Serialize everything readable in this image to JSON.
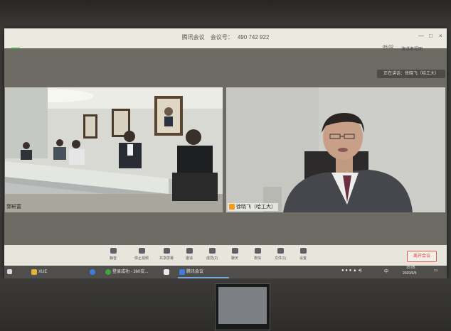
{
  "meeting_window": {
    "title": "腾讯会议",
    "meeting_id_label": "会议号：",
    "meeting_id": "490 742 922",
    "duration": "05:02",
    "view_button": "演讲者视图",
    "window_controls": [
      "—",
      "□",
      "×"
    ]
  },
  "speaking_indicator": "正在讲话：徐晓飞（哈工大）",
  "participants": [
    {
      "name": "郭轩富"
    },
    {
      "name": "徐晓飞（哈工大）"
    }
  ],
  "toolbar": {
    "items": [
      {
        "label": "静音",
        "icon": "mic-icon"
      },
      {
        "label": "停止视频",
        "icon": "camera-icon"
      },
      {
        "label": "共享屏幕",
        "icon": "screen-share-icon"
      },
      {
        "label": "邀请",
        "icon": "invite-icon"
      },
      {
        "label": "成员(2)",
        "icon": "members-icon"
      },
      {
        "label": "聊天",
        "icon": "chat-icon"
      },
      {
        "label": "表情",
        "icon": "emoji-icon"
      },
      {
        "label": "文件(1)",
        "icon": "file-icon"
      },
      {
        "label": "设置",
        "icon": "settings-icon"
      }
    ],
    "end_label": "离开会议"
  },
  "taskbar": {
    "items": [
      {
        "label": "XUE",
        "color": "#e2b43a"
      },
      {
        "label": "登录成功 - 360安...",
        "color": "#3fa43c"
      },
      {
        "label": "腾讯会议",
        "color": "#3b7de0"
      }
    ],
    "ime": "中",
    "time": "15:05",
    "date": "2020/6/5"
  },
  "colors": {
    "accent_orange": "#f59a1d",
    "end_red": "#d8443a",
    "screen_bg": "#6e6b64"
  }
}
